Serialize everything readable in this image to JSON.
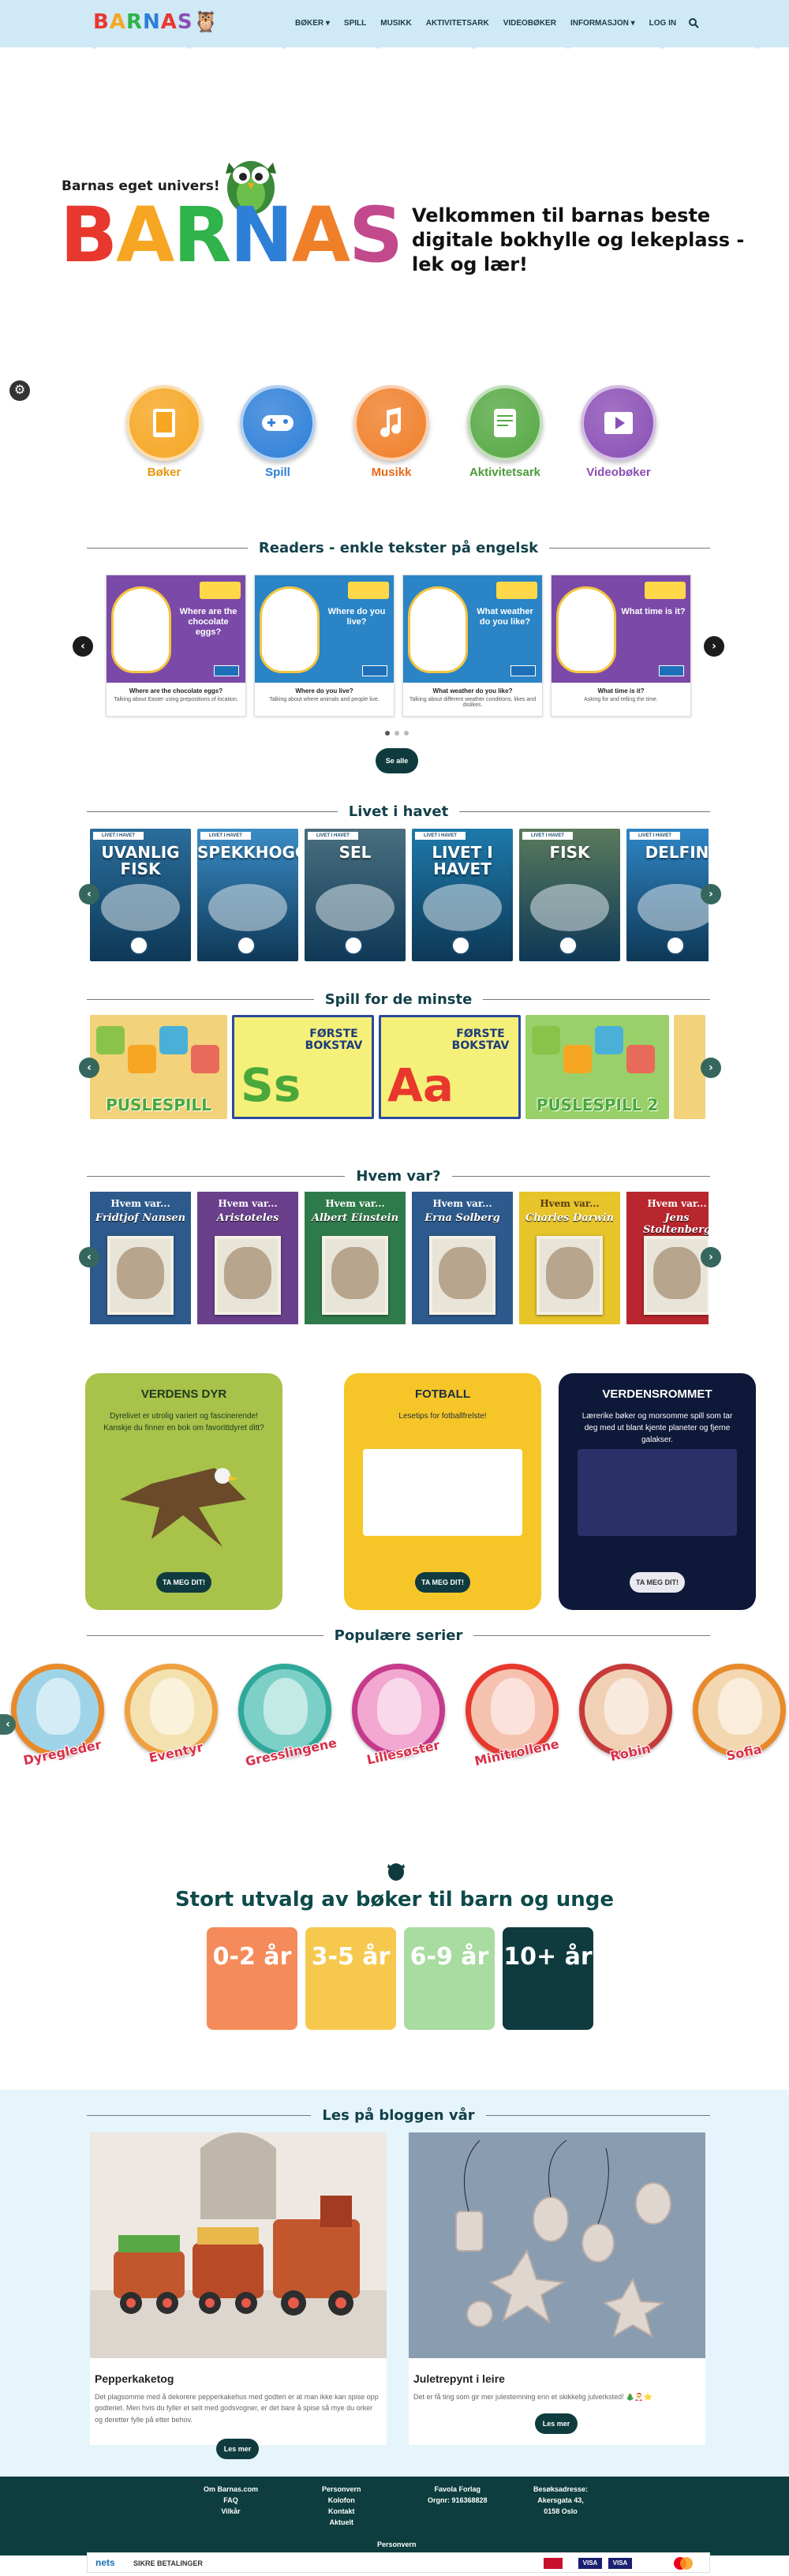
{
  "header": {
    "logo": "BARNAS",
    "nav": [
      "BØKER ▾",
      "SPILL",
      "MUSIKK",
      "AKTIVITETSARK",
      "VIDEOBØKER",
      "INFORMASJON ▾",
      "LOG IN"
    ]
  },
  "hero": {
    "tagline": "Barnas eget univers!",
    "logo": "BARNAS",
    "welcome": "Velkommen til barnas beste digitale bokhylle og lekeplass - lek og lær!"
  },
  "categories": [
    {
      "label": "Bøker",
      "color": "#f6a623",
      "text_color": "#e8960c",
      "icon": "tablet-icon"
    },
    {
      "label": "Spill",
      "color": "#2e7fd8",
      "text_color": "#2e7fd8",
      "icon": "gamepad-icon"
    },
    {
      "label": "Musikk",
      "color": "#f07f2a",
      "text_color": "#e8691a",
      "icon": "music-note-icon"
    },
    {
      "label": "Aktivitetsark",
      "color": "#56a844",
      "text_color": "#4a9a3a",
      "icon": "scroll-icon"
    },
    {
      "label": "Videobøker",
      "color": "#8a4fb5",
      "text_color": "#8a4fb5",
      "icon": "play-icon"
    }
  ],
  "readers": {
    "heading": "Readers - enkle tekster på engelsk",
    "items": [
      {
        "question": "Where are the chocolate eggs?",
        "title": "Where are the chocolate eggs?",
        "desc": "Talking about Easter using prepositions of location.",
        "bg": "#7b4aa8"
      },
      {
        "question": "Where do you live?",
        "title": "Where do you live?",
        "desc": "Talking about where animals and people live.",
        "bg": "#2a84c6"
      },
      {
        "question": "What weather do you like?",
        "title": "What weather do you like?",
        "desc": "Talking about different weather conditions, likes and dislikes.",
        "bg": "#2a84c6"
      },
      {
        "question": "What time is it?",
        "title": "What time is it?",
        "desc": "Asking for and telling the time.",
        "bg": "#7b4aa8"
      }
    ],
    "button": "Se alle"
  },
  "sea": {
    "heading": "Livet i havet",
    "books": [
      {
        "title": "UVANLIG FISK",
        "bg": "#2a6d9c"
      },
      {
        "title": "SPEKKHOGGER",
        "bg": "#3b8cc6"
      },
      {
        "title": "SEL",
        "bg": "#4a6f80"
      },
      {
        "title": "LIVET I HAVET",
        "bg": "#1d7aaa"
      },
      {
        "title": "FISK",
        "bg": "#5a7a5c"
      },
      {
        "title": "DELFIN",
        "bg": "#2f86c6"
      }
    ],
    "book_header": "LIVET I HAVET"
  },
  "games": {
    "heading": "Spill for de minste",
    "items": [
      {
        "title": "PUSLESPILL",
        "bg": "#f2d27a",
        "w": 174
      },
      {
        "title": "FØRSTE BOKSTAV",
        "letter": "Ss",
        "bg": "#f5f07a",
        "w": 180
      },
      {
        "title": "FØRSTE BOKSTAV",
        "letter": "Aa",
        "bg": "#f5f07a",
        "w": 180
      },
      {
        "title": "PUSLESPILL 2",
        "bg": "#9ad06a",
        "w": 182
      },
      {
        "title": "",
        "bg": "#f2d27a",
        "w": 40
      }
    ]
  },
  "who": {
    "heading": "Hvem var?",
    "prefix": "Hvem var...",
    "books": [
      {
        "name": "Fridtjof Nansen",
        "bg": "#2d5a8c"
      },
      {
        "name": "Aristoteles",
        "bg": "#6a3f8c"
      },
      {
        "name": "Albert Einstein",
        "bg": "#2f7a4a"
      },
      {
        "name": "Erna Solberg",
        "bg": "#2d5a8c"
      },
      {
        "name": "Charles Darwin",
        "bg": "#e6c42a"
      },
      {
        "name": "Jens Stoltenberg",
        "bg": "#b8262e"
      }
    ]
  },
  "features": [
    {
      "title": "VERDENS DYR",
      "desc": "Dyrelivet er utrolig variert og fascinerende! Kanskje du finner en bok om favorittdyret ditt?",
      "button": "TA MEG DIT!",
      "bg": "#a8c24a",
      "fg": "#1e3a1e"
    },
    {
      "title": "FOTBALL",
      "desc": "Lesetips for fotballfrelste!",
      "button": "TA MEG DIT!",
      "bg": "#f6c628",
      "fg": "#1e2e3e"
    },
    {
      "title": "VERDENSROMMET",
      "desc": "Lærerike bøker og morsomme spill som tar deg med ut blant kjente planeter og fjerne galakser.",
      "button": "TA MEG DIT!",
      "bg": "#0e1838",
      "fg": "#ffffff"
    }
  ],
  "popular": {
    "heading": "Populære serier",
    "items": [
      {
        "label": "Dyregleder",
        "bg": "#9fd4e8"
      },
      {
        "label": "Eventyr",
        "bg": "#f3e2b0"
      },
      {
        "label": "Gresslingene",
        "bg": "#7cd0c8"
      },
      {
        "label": "Lillesøster",
        "bg": "#f2a8d0"
      },
      {
        "label": "Minitrollene",
        "bg": "#f6c2b0"
      },
      {
        "label": "Robin",
        "bg": "#f1d1b5"
      },
      {
        "label": "Sofia",
        "bg": "#f3d7b0"
      }
    ]
  },
  "ages": {
    "heading": "Stort utvalg av bøker til barn og unge",
    "items": [
      {
        "label": "0-2 år",
        "bg": "#f58b5a"
      },
      {
        "label": "3-5 år",
        "bg": "#f6c94e"
      },
      {
        "label": "6-9 år",
        "bg": "#a8dca0"
      },
      {
        "label": "10+ år",
        "bg": "#0f3b3f"
      }
    ]
  },
  "blog": {
    "heading": "Les på bloggen vår",
    "posts": [
      {
        "title": "Pepperkaketog",
        "desc": "Det plagsomme med å dekorere pepperkakehus med godteri er at man ikke kan spise opp godteriet. Men hvis du fyller et selt med godsvogner, er det bare å spise så mye du orker og deretter fylle på etter behov.",
        "button": "Les mer"
      },
      {
        "title": "Juletrepynt i leire",
        "desc": "Det er få ting som gir mer julestemning enn et skikkelig julverksted! 🎄🎅⭐",
        "button": "Les mer"
      }
    ]
  },
  "footer": {
    "col1": [
      "Om Barnas.com",
      "FAQ",
      "Vilkår"
    ],
    "col2": [
      "Personvern",
      "Kolofon",
      "Kontakt",
      "Aktuelt"
    ],
    "col3": [
      "Favola Forlag",
      "Orgnr: 916368828"
    ],
    "col4": [
      "Besøksadresse:",
      "Akersgata 43,",
      "0158 Oslo"
    ],
    "bottom": "Personvern"
  },
  "payments": {
    "nets": "nets",
    "secure": "SIKRE BETALINGER",
    "cards": [
      "VISA",
      "VISA",
      "MC"
    ]
  }
}
